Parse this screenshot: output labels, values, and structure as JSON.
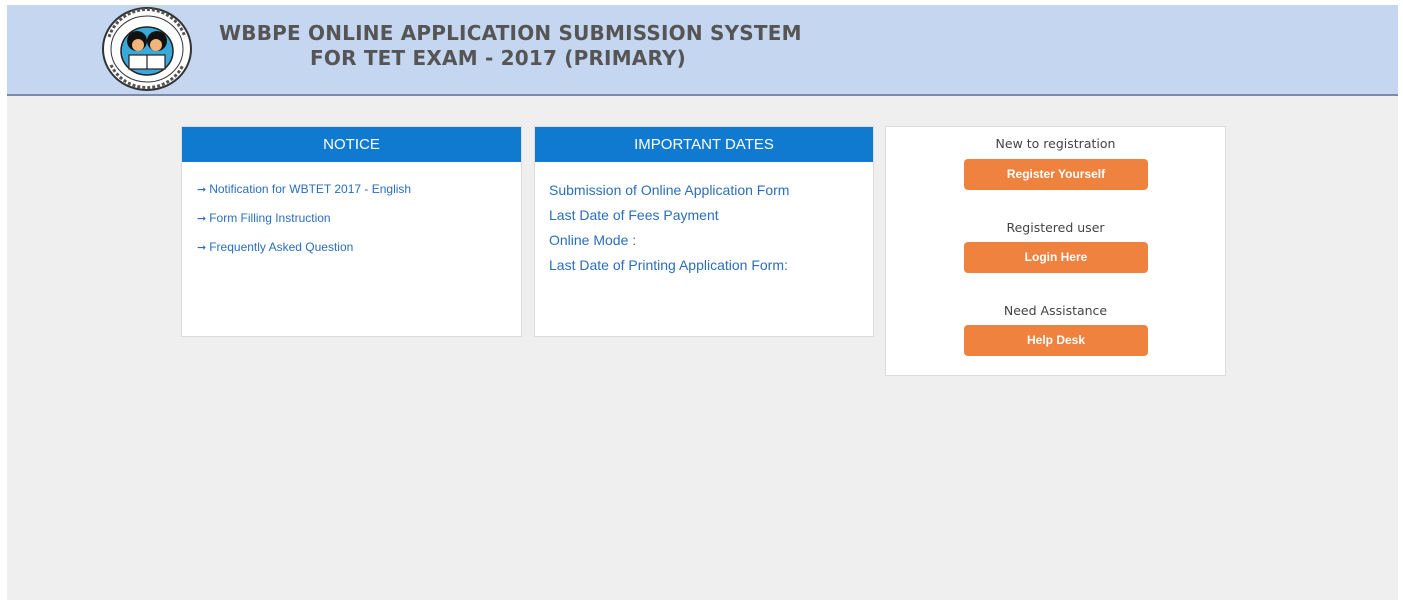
{
  "header": {
    "title_line1": "WBBPE ONLINE APPLICATION SUBMISSION SYSTEM",
    "title_line2": "FOR TET EXAM - 2017 (PRIMARY)",
    "logo_icon": "wbbpe-emblem-icon",
    "background_color": "#c4d6f0"
  },
  "notice": {
    "heading": "NOTICE",
    "arrow_glyph": "➞",
    "items": [
      "Notification for WBTET 2017 - English",
      "Form Filling Instruction",
      "Frequently Asked Question"
    ]
  },
  "important_dates": {
    "heading": "IMPORTANT DATES",
    "items": [
      "Submission of Online Application Form",
      "Last Date of Fees Payment",
      "Online Mode :",
      "Last Date of Printing Application Form:"
    ]
  },
  "actions": {
    "new_label": "New to registration",
    "register_button": "Register Yourself",
    "registered_label": "Registered user",
    "login_button": "Login Here",
    "assist_label": "Need Assistance",
    "help_button": "Help Desk"
  },
  "colors": {
    "panel_header": "#0f7ad0",
    "action_button": "#f0823f",
    "link": "#2a6ebd",
    "page_background": "#efefef"
  }
}
